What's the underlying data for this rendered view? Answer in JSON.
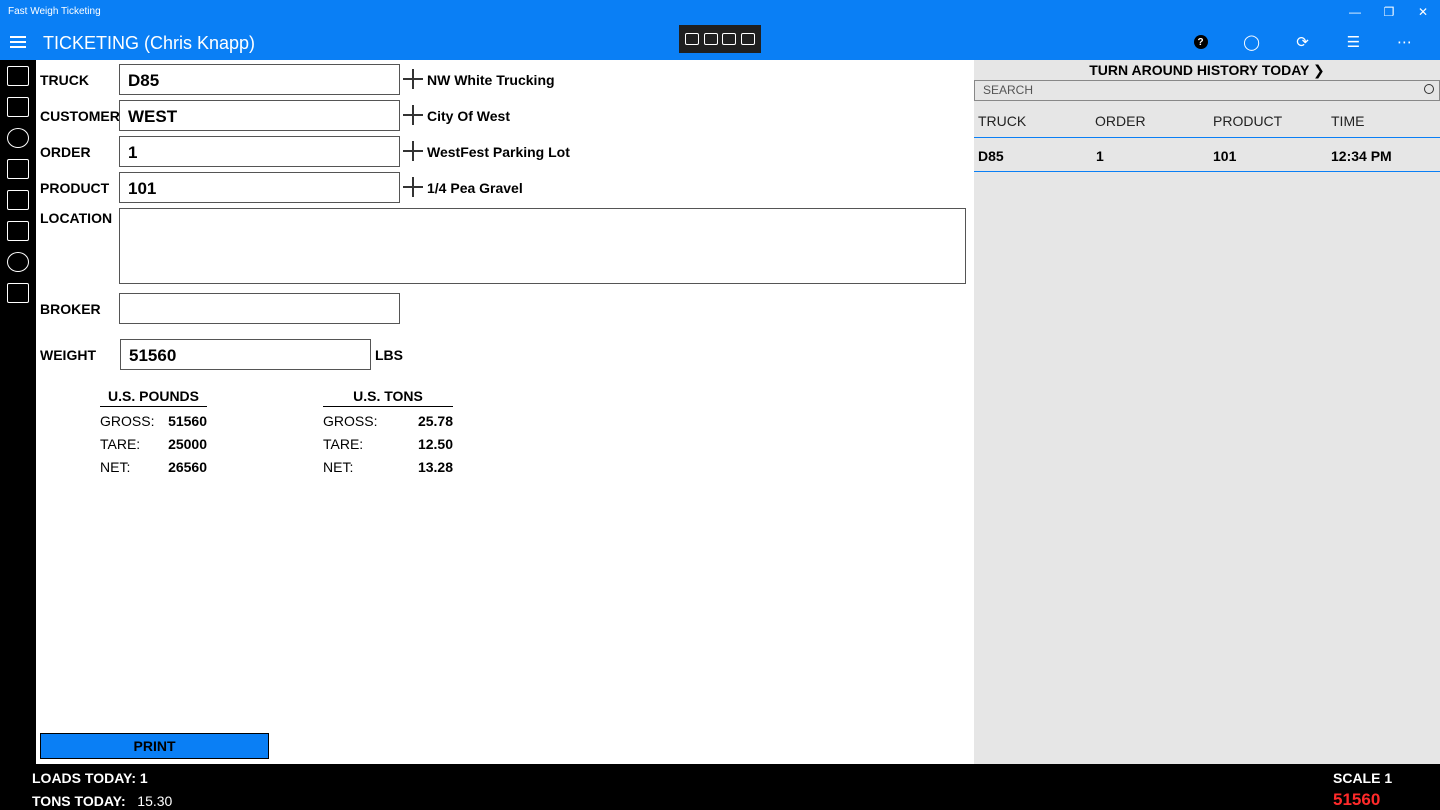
{
  "window": {
    "title": "Fast Weigh Ticketing",
    "controls": [
      "minimize",
      "restore",
      "close"
    ]
  },
  "header": {
    "title": "TICKETING (Chris Knapp)",
    "icons": [
      "help-icon",
      "account-icon",
      "refresh-icon",
      "settings-icon",
      "more-icon"
    ],
    "toolbar_icons": [
      "select-icon",
      "pointer-icon",
      "frame-icon",
      "inspect-icon"
    ]
  },
  "rail": {
    "icons": [
      "ticketing-icon",
      "truck-icon",
      "customer-icon",
      "order-icon",
      "reports-icon",
      "search-list-icon",
      "globe-icon",
      "news-icon"
    ]
  },
  "form": {
    "truck": {
      "label": "TRUCK",
      "value": "D85",
      "desc": "NW White Trucking"
    },
    "customer": {
      "label": "CUSTOMER",
      "value": "WEST",
      "desc": "City Of West"
    },
    "order": {
      "label": "ORDER",
      "value": "1",
      "desc": "WestFest Parking Lot"
    },
    "product": {
      "label": "PRODUCT",
      "value": "101",
      "desc": "1/4 Pea Gravel"
    },
    "location": {
      "label": "LOCATION",
      "value": ""
    },
    "broker": {
      "label": "BROKER",
      "value": ""
    },
    "weight": {
      "label": "WEIGHT",
      "value": "51560",
      "unit": "LBS"
    }
  },
  "summary": {
    "pounds": {
      "title": "U.S. POUNDS",
      "gross_label": "GROSS:",
      "gross": "51560",
      "tare_label": "TARE:",
      "tare": "25000",
      "net_label": "NET:",
      "net": "26560"
    },
    "tons": {
      "title": "U.S. TONS",
      "gross_label": "GROSS:",
      "gross": "25.78",
      "tare_label": "TARE:",
      "tare": "12.50",
      "net_label": "NET:",
      "net": "13.28"
    }
  },
  "print_label": "PRINT",
  "history": {
    "title": "TURN AROUND HISTORY TODAY",
    "search_placeholder": "SEARCH",
    "columns": [
      "TRUCK",
      "ORDER",
      "PRODUCT",
      "TIME"
    ],
    "rows": [
      {
        "truck": "D85",
        "order": "1",
        "product": "101",
        "time": "12:34 PM"
      }
    ]
  },
  "footer": {
    "loads_label": "LOADS TODAY:",
    "loads_value": "1",
    "tons_label": "TONS TODAY:",
    "tons_value": "15.30",
    "scale_label": "SCALE 1",
    "scale_value": "51560",
    "scale_color": "#ff2a2a"
  }
}
